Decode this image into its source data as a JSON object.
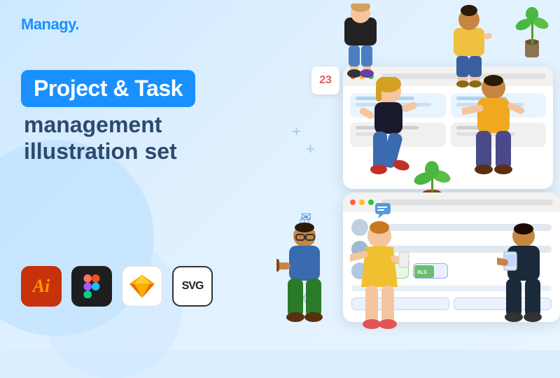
{
  "logo": {
    "text": "Managy."
  },
  "headline": {
    "line1": "Project & Task",
    "line2": "management",
    "line3": "illustration set"
  },
  "tools": [
    {
      "id": "ai",
      "label": "Ai",
      "type": "illustrator"
    },
    {
      "id": "figma",
      "label": "Figma",
      "type": "figma"
    },
    {
      "id": "sketch",
      "label": "Sketch",
      "type": "sketch"
    },
    {
      "id": "svg",
      "label": "SVG",
      "type": "svg"
    }
  ],
  "calendar": {
    "day": "23"
  },
  "browser_top": {
    "dots": [
      "red",
      "yellow",
      "green"
    ]
  },
  "browser_bottom": {
    "dots": [
      "red",
      "yellow",
      "green"
    ]
  }
}
